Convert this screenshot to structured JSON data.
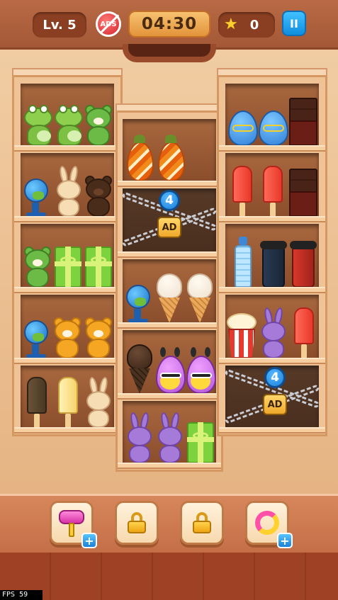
{
  "hud": {
    "level_label": "Lv. 5",
    "ads_label": "ADS",
    "timer": "04:30",
    "star_count": "0",
    "pause_label": "II"
  },
  "locks": {
    "middle_locked_count": "4",
    "right_locked_count": "4",
    "ad_label": "AD"
  },
  "shelves": {
    "left": [
      [
        "frog",
        "frog",
        "green-bear"
      ],
      [
        "globe",
        "cream-bunny",
        "brown-bear"
      ],
      [
        "green-bear",
        "green-gift",
        "green-gift"
      ],
      [
        "globe",
        "orange-bear",
        "orange-bear"
      ],
      [
        "dark-popsicle",
        "cream-popsicle",
        "cream-bunny"
      ]
    ],
    "middle": [
      [
        "orange-egg",
        "orange-egg"
      ],
      [
        "locked"
      ],
      [
        "globe",
        "vanilla-cone",
        "vanilla-cone"
      ],
      [
        "chocolate-cone",
        "alien-egg",
        "alien-egg"
      ],
      [
        "purple-bunny",
        "purple-bunny",
        "green-gift"
      ]
    ],
    "right": [
      [
        "blue-egg",
        "blue-egg",
        "chocolate-bar"
      ],
      [
        "red-popsicle",
        "red-popsicle",
        "chocolate-bar"
      ],
      [
        "water-bottle",
        "navy-cup",
        "red-cup"
      ],
      [
        "popcorn",
        "purple-bunny",
        "red-popsicle"
      ],
      [
        "locked"
      ]
    ]
  },
  "tools": [
    {
      "name": "hammer",
      "plus": "+"
    },
    {
      "name": "locked-slot"
    },
    {
      "name": "locked-slot"
    },
    {
      "name": "shuffle",
      "plus": "+"
    }
  ],
  "debug": {
    "fps": "FPS  59"
  },
  "colors": {
    "topbar": "#a45836",
    "shelf": "#f0c397",
    "timer": "#f6c170",
    "pause": "#1b8fe0"
  }
}
